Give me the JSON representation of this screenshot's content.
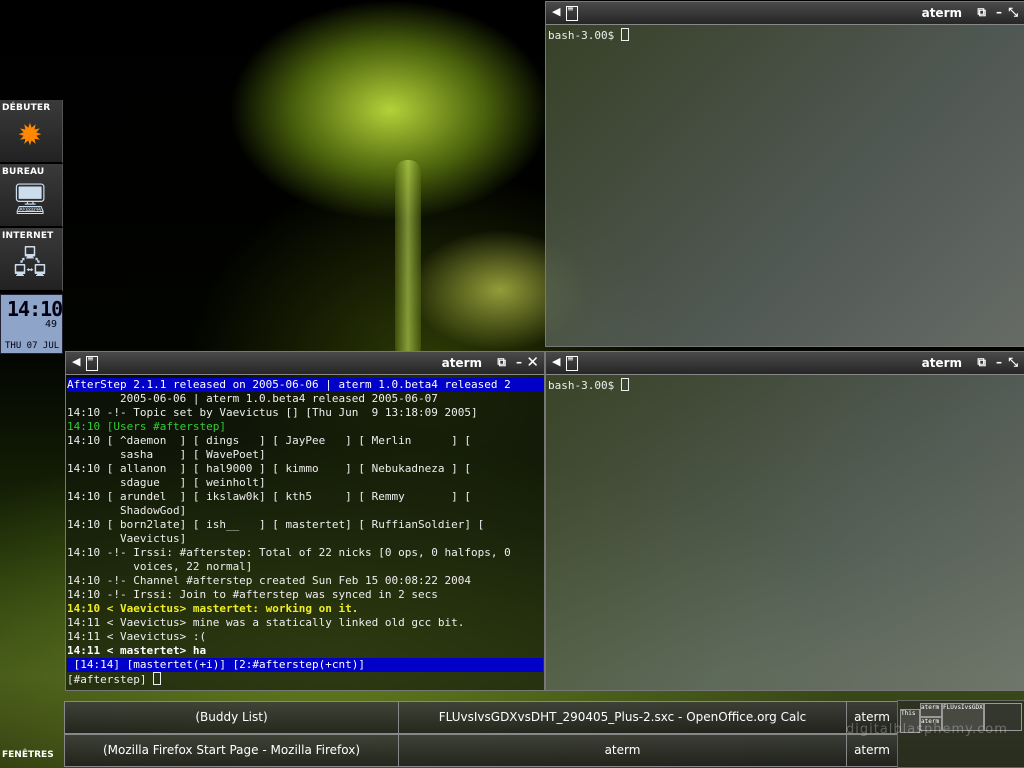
{
  "wharf": {
    "items": [
      {
        "label": "DÉBUTER",
        "icon": "sun-icon"
      },
      {
        "label": "BUREAU",
        "icon": "computer-icon"
      },
      {
        "label": "INTERNET",
        "icon": "network-icon"
      }
    ],
    "clock": {
      "time": "14:10",
      "seconds": "49",
      "date": "THU 07 JUL"
    }
  },
  "windows": {
    "top_right": {
      "title": "aterm",
      "prompt": "bash-3.00$"
    },
    "bottom_right": {
      "title": "aterm",
      "prompt": "bash-3.00$"
    },
    "irssi": {
      "title": "aterm",
      "topic": "AfterStep 2.1.1 released on 2005-06-06 | aterm 1.0.beta4 released 2",
      "input": "[#afterstep] ",
      "status": " [14:14] [mastertet(+i)] [2:#afterstep(+cnt)]"
    }
  },
  "irc_lines": [
    "        2005-06-06 | aterm 1.0.beta4 released 2005-06-07",
    "14:10 -!- Topic set by Vaevictus [] [Thu Jun  9 13:18:09 2005]",
    "14:10 [Users #afterstep]",
    "14:10 [ ^daemon  ] [ dings   ] [ JayPee   ] [ Merlin      ] [",
    "        sasha    ] [ WavePoet]",
    "14:10 [ allanon  ] [ hal9000 ] [ kimmo    ] [ Nebukadneza ] [",
    "        sdague   ] [ weinholt]",
    "14:10 [ arundel  ] [ ikslaw0k] [ kth5     ] [ Remmy       ] [",
    "        ShadowGod]",
    "14:10 [ born2late] [ ish__   ] [ mastertet] [ RuffianSoldier] [",
    "        Vaevictus]",
    "14:10 -!- Irssi: #afterstep: Total of 22 nicks [0 ops, 0 halfops, 0",
    "          voices, 22 normal]",
    "14:10 -!- Channel #afterstep created Sun Feb 15 00:08:22 2004",
    "14:10 -!- Irssi: Join to #afterstep was synced in 2 secs",
    "14:10 < Vaevictus> mastertet: working on it.",
    "14:11 < Vaevictus> mine was a statically linked old gcc bit.",
    "14:11 < Vaevictus> :(",
    "14:11 < mastertet> ha"
  ],
  "taskbar": {
    "label": "FENÊTRES",
    "tasks": [
      "(Buddy List)",
      "FLUvsIvsGDXvsDHT_290405_Plus-2.sxc - OpenOffice.org Calc",
      "aterm",
      "(Mozilla Firefox Start Page - Mozilla Firefox)",
      "aterm",
      "aterm"
    ],
    "pager": [
      "This",
      "aterm",
      "aterm",
      "FLUvsIvsGDX"
    ]
  },
  "watermark": "digitalblasphemy.com"
}
